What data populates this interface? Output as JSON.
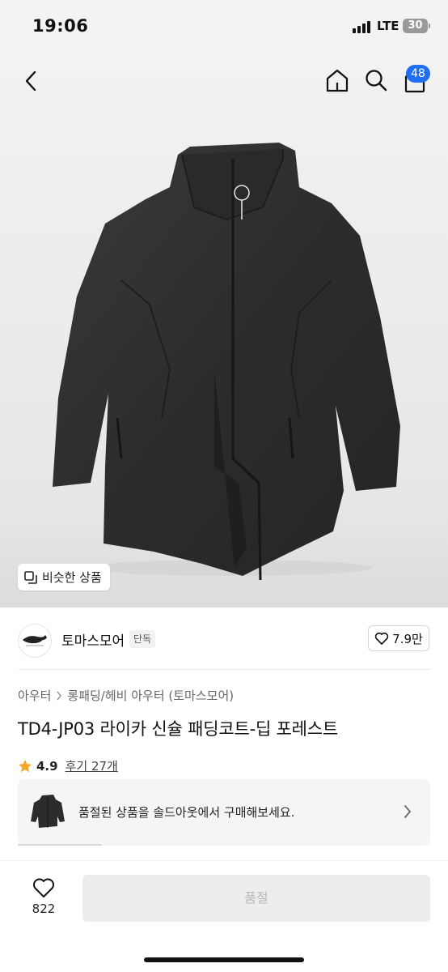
{
  "status_bar": {
    "time": "19:06",
    "network": "LTE",
    "battery": "30"
  },
  "header": {
    "back_icon": "chevron-left-icon",
    "home_icon": "home-icon",
    "search_icon": "search-icon",
    "cart_icon": "bag-icon",
    "cart_count": "48",
    "badge_color": "#1f6ff0"
  },
  "hero": {
    "image_subject": "dark grey long padded coat",
    "similar_label": "비슷한 상품"
  },
  "brand": {
    "name": "토마스모어",
    "tag": "단독",
    "likes": "7.9만"
  },
  "product": {
    "category": "아우터",
    "subcategory": "롱패딩/헤비 아우터 (토마스모어)",
    "title": "TD4-JP03 라이카 신슐 패딩코트-딥 포레스트",
    "rating": "4.9",
    "reviews": "후기 27개",
    "star_color": "#f5a623"
  },
  "soldout_banner": {
    "text": "품절된 상품을 솔드아웃에서 구매해보세요."
  },
  "bottom_bar": {
    "wish_count": "822",
    "buy_label": "품절"
  }
}
